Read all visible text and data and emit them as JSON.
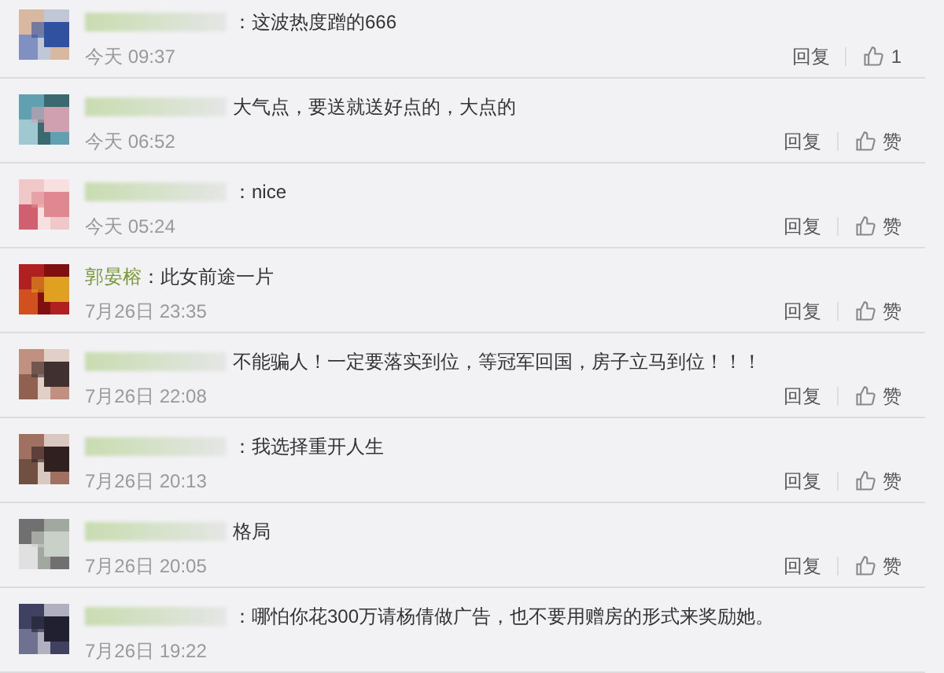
{
  "comments": [
    {
      "kind": "redacted",
      "text": "：这波热度蹭的666",
      "time": "今天 09:37",
      "reply": "回复",
      "like": "1"
    },
    {
      "kind": "redacted",
      "text": "大气点，要送就送好点的，大点的",
      "time": "今天 06:52",
      "reply": "回复",
      "like": "赞"
    },
    {
      "kind": "redacted",
      "text": "：nice",
      "time": "今天 05:24",
      "reply": "回复",
      "like": "赞"
    },
    {
      "kind": "named",
      "name": "郭晏榕",
      "text": "：此女前途一片",
      "time": "7月26日 23:35",
      "reply": "回复",
      "like": "赞"
    },
    {
      "kind": "redacted",
      "text": "不能骗人！一定要落实到位，等冠军回国，房子立马到位！！！",
      "time": "7月26日 22:08",
      "reply": "回复",
      "like": "赞"
    },
    {
      "kind": "redacted",
      "text": "：我选择重开人生",
      "time": "7月26日 20:13",
      "reply": "回复",
      "like": "赞"
    },
    {
      "kind": "redacted",
      "text": "格局",
      "time": "7月26日 20:05",
      "reply": "回复",
      "like": "赞"
    },
    {
      "kind": "redacted",
      "text": "：哪怕你花300万请杨倩做广告，也不要用赠房的形式来奖励她。",
      "time": "7月26日 19:22"
    }
  ]
}
